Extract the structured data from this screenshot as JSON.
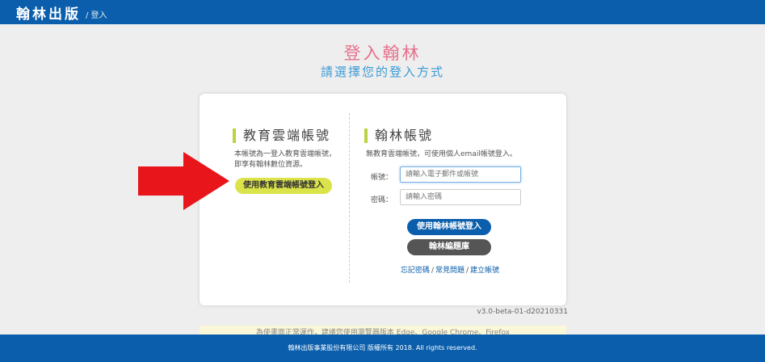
{
  "header": {
    "brand": "翰林出版",
    "crumb": "/ 登入"
  },
  "headline": {
    "title": "登入翰林",
    "subtitle": "請選擇您的登入方式"
  },
  "left": {
    "title": "教育雲端帳號",
    "desc": "本帳號為一登入教育雲端帳號，即享有翰林數位資源。",
    "button": "使用教育雲端帳號登入"
  },
  "right": {
    "title": "翰林帳號",
    "desc": "無教育雲端帳號，可使用個人email帳號登入。",
    "account_label": "帳號：",
    "account_placeholder": "請輸入電子郵件或帳號",
    "password_label": "密碼：",
    "password_placeholder": "請輸入密碼",
    "login_button": "使用翰林帳號登入",
    "portal_button": "翰林編題庫",
    "links": [
      "忘記密碼",
      "常見問題",
      "建立帳號"
    ]
  },
  "version": "v3.0-beta-01-d20210331",
  "notice": "為使畫面正常運作，建議您使用瀏覽器版本 Edge、Google Chrome、Firefox",
  "footer": "翰林出版事業股份有限公司 版權所有 2018. All rights reserved.",
  "colors": {
    "brand_blue": "#0a5eab",
    "accent_pink": "#e6718c",
    "accent_green": "#b9d443",
    "arrow_red": "#e8151b"
  },
  "icons": [
    "red-arrow-icon"
  ]
}
